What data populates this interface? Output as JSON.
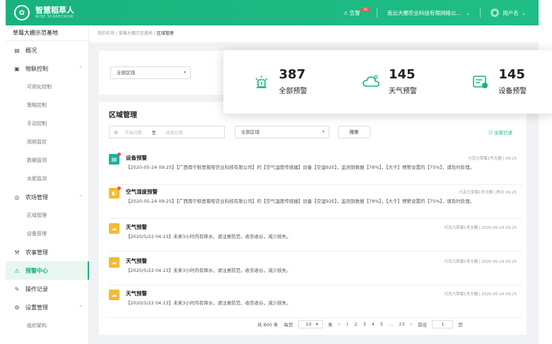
{
  "header": {
    "brand": "智慧稻草人",
    "brand_sub": "WISE SCARECROW",
    "alarm_label": "告警",
    "alarm_count": "15",
    "company": "南云大棚农业科技有限网络公...",
    "username": "用户名"
  },
  "sidebar": {
    "farm": "草莓大棚示范基地",
    "items": [
      {
        "label": "概况",
        "icon": "document-icon",
        "type": "item"
      },
      {
        "label": "物联控制",
        "icon": "monitor-icon",
        "type": "group"
      },
      {
        "label": "可视化控制",
        "type": "sub"
      },
      {
        "label": "策略控制",
        "type": "sub"
      },
      {
        "label": "手动控制",
        "type": "sub"
      },
      {
        "label": "视频监控",
        "type": "sub"
      },
      {
        "label": "数据监测",
        "type": "sub"
      },
      {
        "label": "水肥监测",
        "type": "sub"
      },
      {
        "label": "农场管理",
        "icon": "farm-icon",
        "type": "group"
      },
      {
        "label": "区域管理",
        "type": "sub"
      },
      {
        "label": "设备管理",
        "type": "sub"
      },
      {
        "label": "农事管理",
        "icon": "tools-icon",
        "type": "item"
      },
      {
        "label": "预警中心",
        "icon": "alert-center-icon",
        "type": "active"
      },
      {
        "label": "操作记录",
        "icon": "edit-record-icon",
        "type": "item"
      },
      {
        "label": "设置管理",
        "icon": "settings-icon",
        "type": "group"
      },
      {
        "label": "组织架构",
        "type": "sub"
      }
    ]
  },
  "breadcrumb": {
    "path": "我的农场 / 草莓大棚示范基地 / ",
    "current": "区域管理"
  },
  "filter": {
    "region_select": "全部区域"
  },
  "stats": [
    {
      "value": "387",
      "label": "全部预警",
      "icon": "alarm-light-icon"
    },
    {
      "value": "145",
      "label": "天气预警",
      "icon": "cloud-icon"
    },
    {
      "value": "145",
      "label": "设备预警",
      "icon": "device-icon"
    }
  ],
  "panel": {
    "title": "区域管理",
    "start_placeholder": "开始日期",
    "to": "至",
    "end_placeholder": "结束日期",
    "region_select": "全部区域",
    "search_label": "搜索",
    "read_all": "全部已读"
  },
  "alerts": [
    {
      "title": "设备预警",
      "meta": "巧克力草莓1号大棚  |  09:25",
      "body": "【2020-05-24 09:25】【广西南宁稻思葡萄农业科技有限公司】的【空气湿度传感器】设备【空湿92E】，监测到数据【78%】，【大于】预警设置的【75%】，请及时处理。",
      "color": "#1cb0a0",
      "icon": "device-alert-icon",
      "unread": true
    },
    {
      "title": "空气湿度预警",
      "meta": "巧克力草莓1号大棚  |  昨日 09:25",
      "body": "【2020-05-24 09:25】【广西南宁稻思葡萄农业科技有限公司】的【空气湿度传感器】设备【空湿92E】，监测到数据【78%】，【大于】预警设置的【75%】，请及时处理。",
      "color": "#f5b935",
      "icon": "humidity-alert-icon",
      "unread": true
    },
    {
      "title": "天气预警",
      "meta": "巧克力草莓1号大棚  |  2020-05-24 09:25",
      "body": "【2020/5/22 04:13】未来3小时内有降水，请注意防范，收衣收谷，减少损失。",
      "color": "#f5b935",
      "icon": "weather-alert-icon",
      "unread": false
    },
    {
      "title": "天气预警",
      "meta": "巧克力草莓1号大棚  |  2020-05-24 09:25",
      "body": "【2020/5/22 04:13】未来3小时内有降水，请注意防范，收衣收谷，减少损失。",
      "color": "#f5b935",
      "icon": "weather-alert-icon",
      "unread": false
    },
    {
      "title": "天气预警",
      "meta": "巧克力草莓1号大棚  |  2020-05-24 09:25",
      "body": "【2020/5/22 04:13】未来3小时内有降水，请注意防范，收衣收谷，减少损失。",
      "color": "#f5b935",
      "icon": "weather-alert-icon",
      "unread": false
    }
  ],
  "pagination": {
    "total": "共 800 条",
    "per_page_label": "每页",
    "per_page": "10",
    "unit": "条",
    "pages": [
      "1",
      "2",
      "3",
      "4",
      "5",
      "...",
      "23"
    ],
    "goto_label": "前往",
    "goto_value": "1",
    "page_unit": "页"
  },
  "colors": {
    "brand": "#18b27e",
    "warning": "#f5b935",
    "danger": "#ff4d4f"
  }
}
